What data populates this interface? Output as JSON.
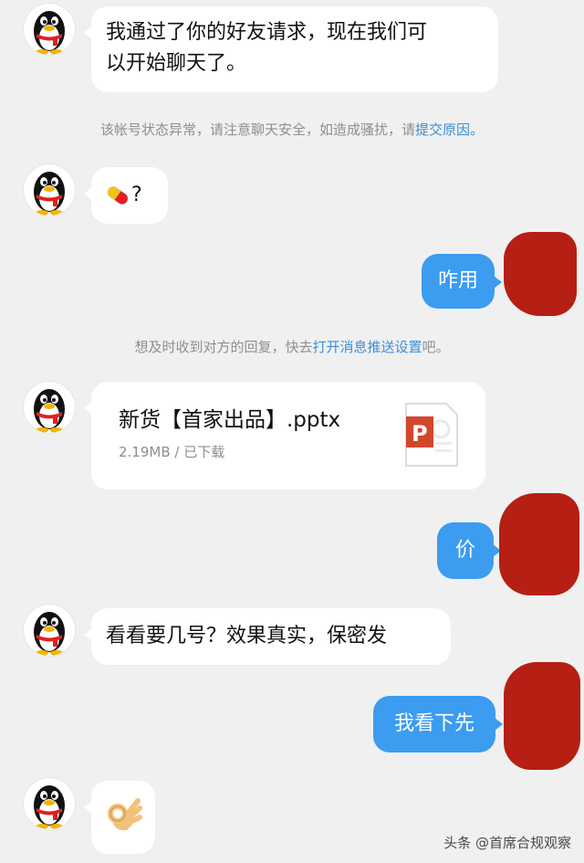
{
  "messages": [
    {
      "from": "contact",
      "text": "我通过了你的好友请求，现在我们可以开始聊天了。",
      "lines": [
        "我通过了你的好友请求，现在我们可",
        "以开始聊天了。"
      ]
    },
    {
      "system": {
        "prefix": "该帐号状态异常，请注意聊天安全，如造成骚扰，请",
        "link": "提交原因",
        "suffix": "。"
      }
    },
    {
      "from": "contact",
      "text": "?",
      "emoji": "pill"
    },
    {
      "from": "me",
      "text": "咋用"
    },
    {
      "system": {
        "prefix": "想及时收到对方的回复，快去",
        "link": "打开消息推送设置",
        "suffix": "吧。"
      }
    },
    {
      "from": "contact",
      "file": {
        "name": "新货【首家出品】.pptx",
        "meta": "2.19MB / 已下载",
        "icon": "powerpoint-file-icon",
        "icon_letter": "P"
      }
    },
    {
      "from": "me",
      "text": "价"
    },
    {
      "from": "contact",
      "text": "看看要几号？效果真实，保密发"
    },
    {
      "from": "me",
      "text": "我看下先"
    },
    {
      "from": "contact",
      "emoji": "ok-hand"
    }
  ],
  "watermark": "头条 @首席合规观察",
  "colors": {
    "background": "#f0f0f0",
    "my_bubble": "#3b9cf0",
    "link": "#3b8ed8",
    "redaction": "#b51f14"
  }
}
